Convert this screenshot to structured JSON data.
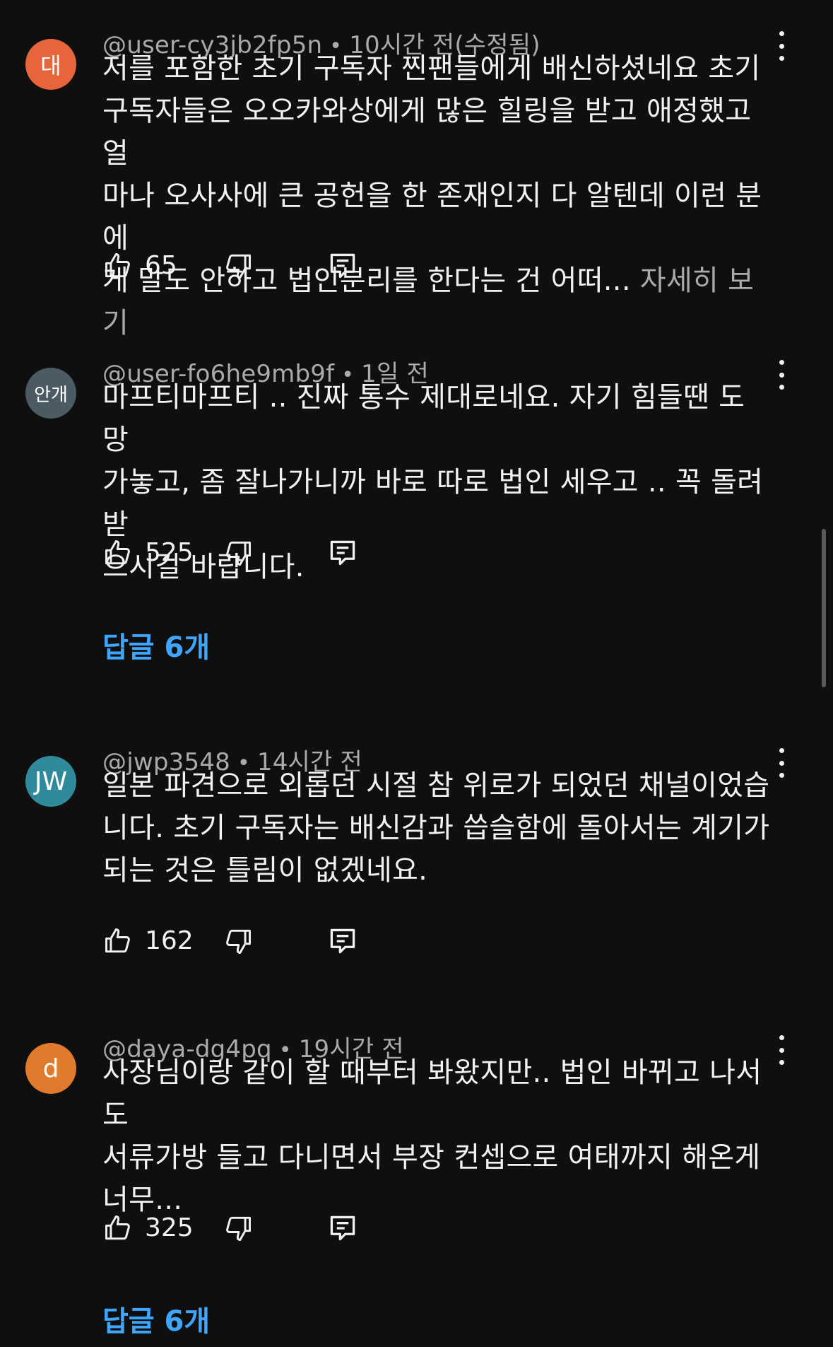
{
  "comments": [
    {
      "avatar_text": "대",
      "avatar_color": "#e8643a",
      "author": "@user-cy3jb2fp5n",
      "separator": "•",
      "time": "10시간 전(수정됨)",
      "lines": [
        "저를 포함한 초기 구독자 찐팬들에게 배신하셨네요 초기",
        "구독자들은 오오카와상에게 많은 힐링을 받고 애정했고 얼",
        "마나 오사사에 큰 공헌을 한 존재인지 다 알텐데 이런 분에",
        "게 말도 안하고 법인분리를 한다는 건 어떠..."
      ],
      "more_label": "자세히 보기",
      "likes": "65"
    },
    {
      "avatar_text": "안개",
      "avatar_color": "#4b5a63",
      "author": "@user-fo6he9mb9f",
      "separator": "•",
      "time": "1일 전",
      "lines": [
        "마프티마프티 .. 진짜 통수 제대로네요. 자기 힘들땐 도망",
        "가놓고, 좀 잘나가니까 바로 따로 법인 세우고 .. 꼭 돌려받",
        "으시길 바랍니다."
      ],
      "likes": "525",
      "replies": "답글 6개"
    },
    {
      "avatar_text": "JW",
      "avatar_color": "#2f8b9b",
      "author": "@jwp3548",
      "separator": "•",
      "time": "14시간 전",
      "lines": [
        "일본 파견으로 외롭던 시절 참 위로가 되었던 채널이었습",
        "니다. 초기 구독자는 배신감과 씁슬함에 돌아서는 계기가",
        "되는 것은 틀림이 없겠네요."
      ],
      "likes": "162"
    },
    {
      "avatar_text": "d",
      "avatar_color": "#e07a2c",
      "author": "@daya-dg4pq",
      "separator": "•",
      "time": "19시간 전",
      "lines": [
        "사장님이랑 같이 할 때부터 봐왔지만.. 법인 바뀌고 나서도",
        "서류가방 들고 다니면서 부장 컨셉으로 여태까지 해온게",
        "너무..."
      ],
      "likes": "325",
      "replies": "답글 6개"
    }
  ],
  "icons": {
    "like": "thumbs-up-icon",
    "dislike": "thumbs-down-icon",
    "reply": "reply-icon",
    "menu": "more-vert-icon"
  },
  "colors": {
    "background": "#0f0f0f",
    "text": "#f1f1f1",
    "secondary_text": "#aaaaaa",
    "link": "#3ea6ff"
  }
}
